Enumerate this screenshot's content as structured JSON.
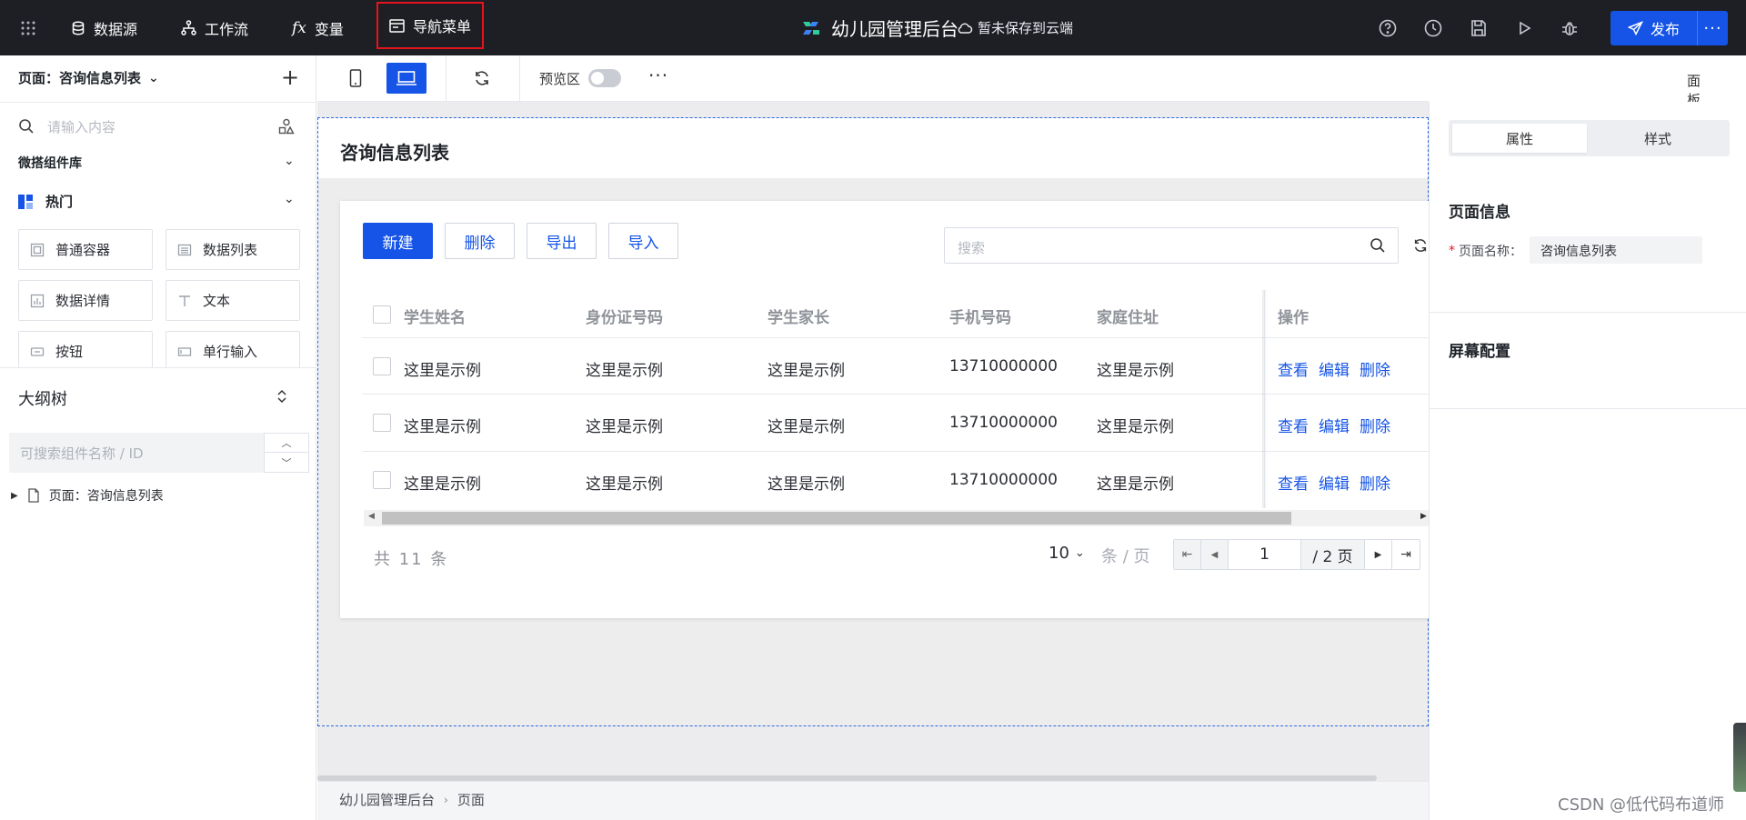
{
  "topbar": {
    "datasource": "数据源",
    "workflow": "工作流",
    "variables": "变量",
    "nav_menu": "导航菜单",
    "app_name": "幼儿园管理后台",
    "save_status": "暂未保存到云端",
    "publish": "发布",
    "more": "···"
  },
  "left": {
    "page_selector": "页面：咨询信息列表",
    "search_placeholder": "请输入内容",
    "library": "微搭组件库",
    "hot": "热门",
    "components": [
      "普通容器",
      "数据列表",
      "数据详情",
      "文本",
      "按钮",
      "单行输入"
    ],
    "outline_title": "大纲树",
    "outline_search_placeholder": "可搜索组件名称 / ID",
    "tree_node": "页面：咨询信息列表"
  },
  "toolbar": {
    "preview_label": "预览区",
    "panel_label": "面板"
  },
  "canvas": {
    "page_title": "咨询信息列表",
    "buttons": [
      "新建",
      "删除",
      "导出",
      "导入"
    ],
    "search_placeholder": "搜索",
    "columns": [
      "学生姓名",
      "身份证号码",
      "学生家长",
      "手机号码",
      "家庭住址",
      "操作"
    ],
    "rows": [
      [
        "这里是示例",
        "这里是示例",
        "这里是示例",
        "13710000000",
        "这里是示例"
      ],
      [
        "这里是示例",
        "这里是示例",
        "这里是示例",
        "13710000000",
        "这里是示例"
      ],
      [
        "这里是示例",
        "这里是示例",
        "这里是示例",
        "13710000000",
        "这里是示例"
      ]
    ],
    "row_actions": [
      "查看",
      "编辑",
      "删除"
    ],
    "total": "共 11 条",
    "page_size": "10",
    "page_size_unit": "条 / 页",
    "current_page": "1",
    "page_total": "/ 2 页",
    "breadcrumb": [
      "幼儿园管理后台",
      "页面"
    ]
  },
  "right": {
    "tabs": [
      "属性",
      "样式"
    ],
    "section_page_info": "页面信息",
    "page_name_label": "页面名称",
    "page_name_value": "咨询信息列表",
    "section_screen": "屏幕配置"
  },
  "watermark": "CSDN @低代码布道师",
  "colors": {
    "topbar_bg": "#1e1f24",
    "primary": "#1554e6",
    "highlight_border": "#e5141c"
  }
}
